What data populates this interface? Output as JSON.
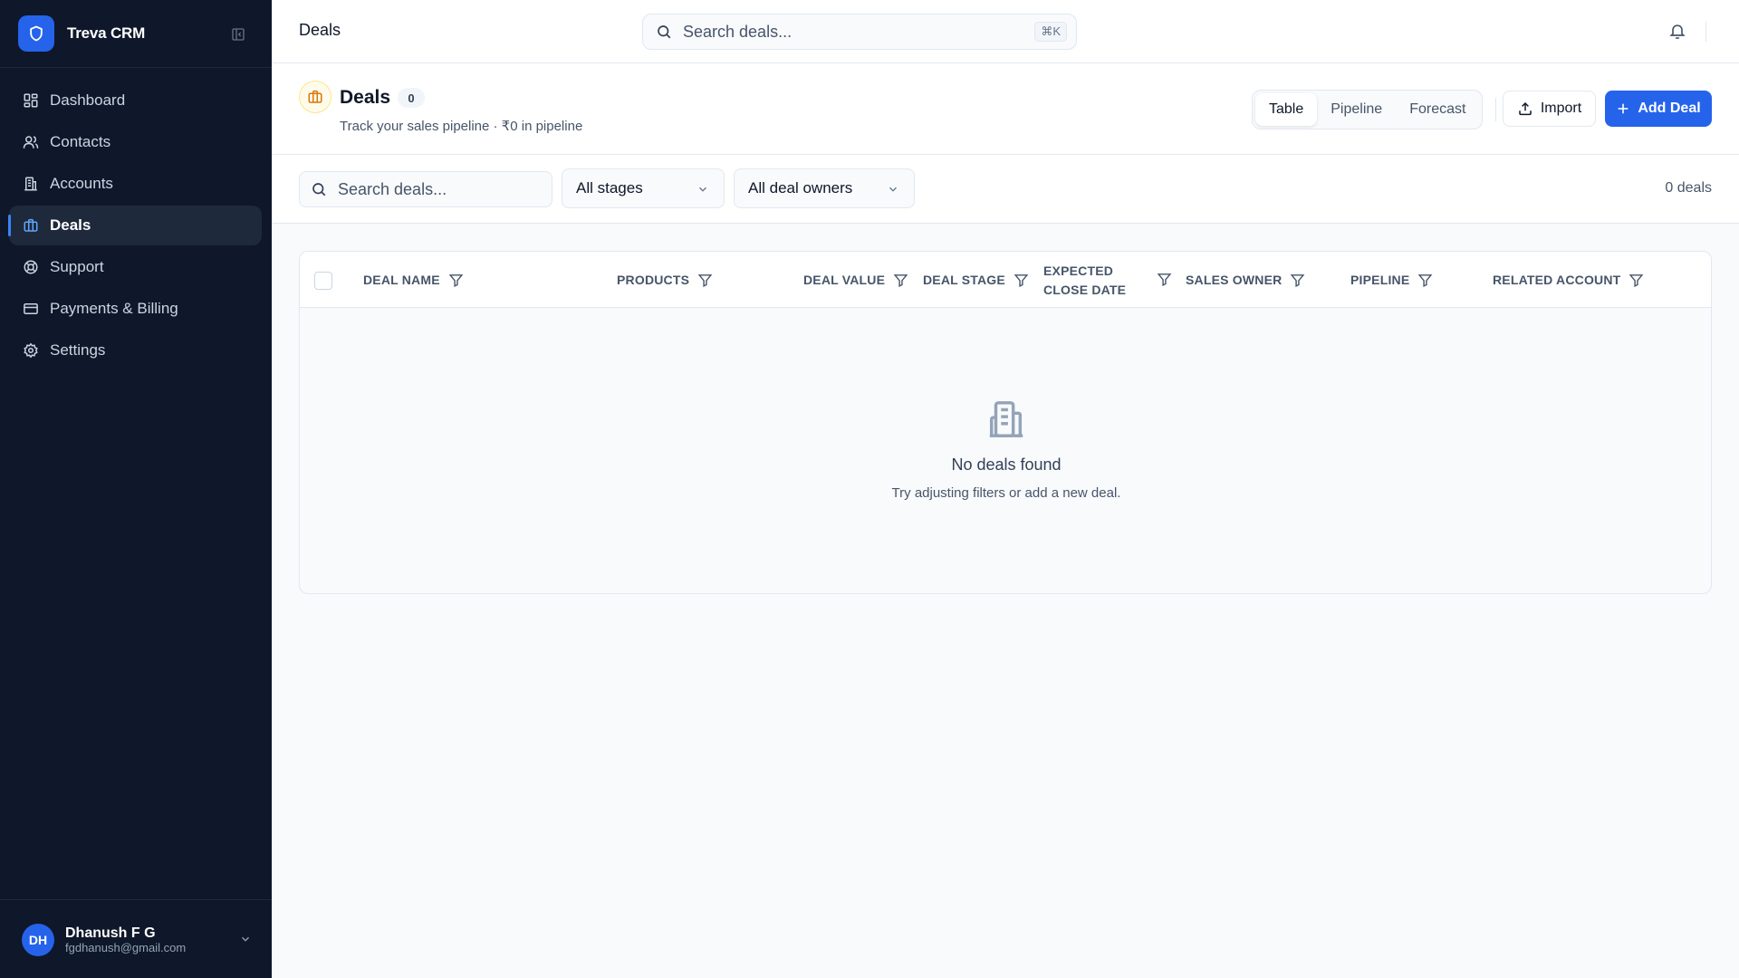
{
  "app": {
    "name": "Treva CRM"
  },
  "sidebar": {
    "items": [
      {
        "label": "Dashboard",
        "icon": "dashboard-icon"
      },
      {
        "label": "Contacts",
        "icon": "users-icon"
      },
      {
        "label": "Accounts",
        "icon": "building-icon"
      },
      {
        "label": "Deals",
        "icon": "briefcase-icon",
        "active": true
      },
      {
        "label": "Support",
        "icon": "lifebuoy-icon"
      },
      {
        "label": "Payments & Billing",
        "icon": "credit-card-icon"
      },
      {
        "label": "Settings",
        "icon": "gear-icon"
      }
    ]
  },
  "user": {
    "initials": "DH",
    "name": "Dhanush F G",
    "email": "fgdhanush@gmail.com"
  },
  "topbar": {
    "title": "Deals",
    "search_placeholder": "Search deals...",
    "shortcut": "⌘K"
  },
  "header": {
    "title": "Deals",
    "count": "0",
    "subtitle": "Track your sales pipeline · ₹0 in pipeline",
    "views": [
      "Table",
      "Pipeline",
      "Forecast"
    ],
    "active_view": "Table",
    "import_label": "Import",
    "add_label": "Add Deal"
  },
  "filters": {
    "search_placeholder": "Search deals...",
    "stage": "All stages",
    "owner": "All deal owners",
    "count_text": "0 deals"
  },
  "table": {
    "columns": [
      "DEAL NAME",
      "PRODUCTS",
      "DEAL VALUE",
      "DEAL STAGE",
      "EXPECTED",
      "CLOSE DATE",
      "SALES OWNER",
      "PIPELINE",
      "RELATED ACCOUNT"
    ],
    "empty_title": "No deals found",
    "empty_sub": "Try adjusting filters or add a new deal."
  },
  "colors": {
    "sidebar_bg": "#0f172a",
    "accent": "#2563eb",
    "page_bg": "#f8fafc"
  }
}
